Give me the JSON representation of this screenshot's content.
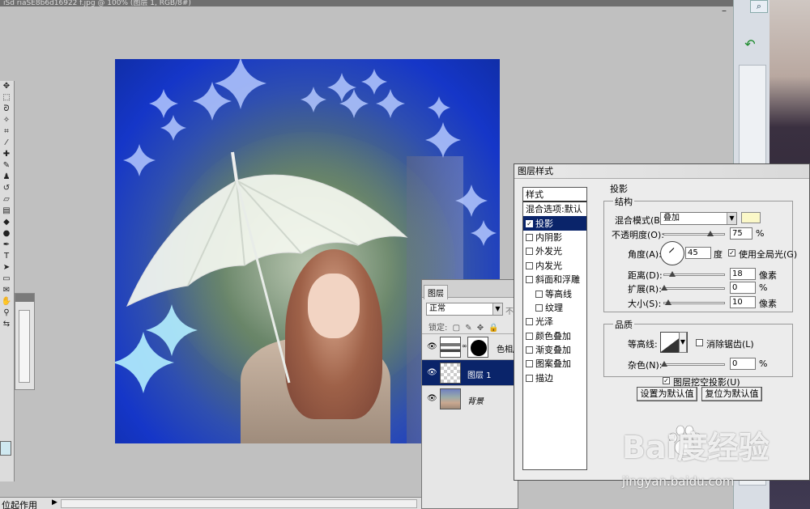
{
  "window": {
    "title_fragment": "iSd riaSE8b6d16922 f.jpg @ 100% (图层 1, RGB/8#)"
  },
  "toolbox": {
    "tools": [
      "move-icon",
      "marquee-icon",
      "lasso-icon",
      "wand-icon",
      "crop-icon",
      "eyedropper-icon",
      "healing-icon",
      "brush-icon",
      "stamp-icon",
      "history-brush-icon",
      "eraser-icon",
      "gradient-icon",
      "blur-icon",
      "dodge-icon",
      "pen-icon",
      "type-icon",
      "path-select-icon",
      "shape-icon",
      "notes-icon",
      "hand-icon",
      "zoom-icon"
    ]
  },
  "status_bar": {
    "text": "位起作用"
  },
  "layers_panel": {
    "tab": "图层",
    "blend_mode": "正常",
    "opacity_label": "不",
    "lock_label": "锁定:",
    "layers": [
      {
        "name": "色相/",
        "type": "adjustment",
        "visible": true,
        "selected": false
      },
      {
        "name": "图层 1",
        "type": "pixel",
        "visible": true,
        "selected": true
      },
      {
        "name": "背景",
        "type": "background",
        "visible": true,
        "selected": false
      }
    ]
  },
  "dialog": {
    "title": "图层样式",
    "styles_header": "样式",
    "styles": [
      {
        "label": "混合选项:默认",
        "checkbox": false,
        "checked": false,
        "sub": false,
        "selected": false
      },
      {
        "label": "投影",
        "checkbox": true,
        "checked": true,
        "sub": false,
        "selected": true
      },
      {
        "label": "内阴影",
        "checkbox": true,
        "checked": false,
        "sub": false,
        "selected": false
      },
      {
        "label": "外发光",
        "checkbox": true,
        "checked": false,
        "sub": false,
        "selected": false
      },
      {
        "label": "内发光",
        "checkbox": true,
        "checked": false,
        "sub": false,
        "selected": false
      },
      {
        "label": "斜面和浮雕",
        "checkbox": true,
        "checked": false,
        "sub": false,
        "selected": false
      },
      {
        "label": "等高线",
        "checkbox": true,
        "checked": false,
        "sub": true,
        "selected": false
      },
      {
        "label": "纹理",
        "checkbox": true,
        "checked": false,
        "sub": true,
        "selected": false
      },
      {
        "label": "光泽",
        "checkbox": true,
        "checked": false,
        "sub": false,
        "selected": false
      },
      {
        "label": "颜色叠加",
        "checkbox": true,
        "checked": false,
        "sub": false,
        "selected": false
      },
      {
        "label": "渐变叠加",
        "checkbox": true,
        "checked": false,
        "sub": false,
        "selected": false
      },
      {
        "label": "图案叠加",
        "checkbox": true,
        "checked": false,
        "sub": false,
        "selected": false
      },
      {
        "label": "描边",
        "checkbox": true,
        "checked": false,
        "sub": false,
        "selected": false
      }
    ],
    "section_title": "投影",
    "structure": {
      "title": "结构",
      "blend_mode_label": "混合模式(B):",
      "blend_mode_value": "叠加",
      "shadow_color": "#fbf8c8",
      "opacity_label": "不透明度(O):",
      "opacity_value": "75",
      "opacity_unit": "%",
      "opacity_fraction": 0.75,
      "angle_label": "角度(A):",
      "angle_value": "45",
      "angle_unit": "度",
      "global_light_label": "使用全局光(G)",
      "global_light_checked": true,
      "distance_label": "距离(D):",
      "distance_value": "18",
      "distance_unit": "像素",
      "spread_label": "扩展(R):",
      "spread_value": "0",
      "spread_unit": "%",
      "size_label": "大小(S):",
      "size_value": "10",
      "size_unit": "像素"
    },
    "quality": {
      "title": "品质",
      "contour_label": "等高线:",
      "antialias_label": "消除锯齿(L)",
      "antialias_checked": false,
      "noise_label": "杂色(N):",
      "noise_value": "0",
      "noise_unit": "%"
    },
    "knockout_label": "图层挖空投影(U)",
    "knockout_checked": true,
    "default_button": "设置为默认值",
    "reset_button": "复位为默认值"
  },
  "watermark": {
    "logo": "Bai度经验",
    "url": "jingyan.baidu.com"
  },
  "colors": {
    "selection": "#0a246a",
    "canvas_bg": "#c0c0c0",
    "panel_bg": "#ececec"
  }
}
